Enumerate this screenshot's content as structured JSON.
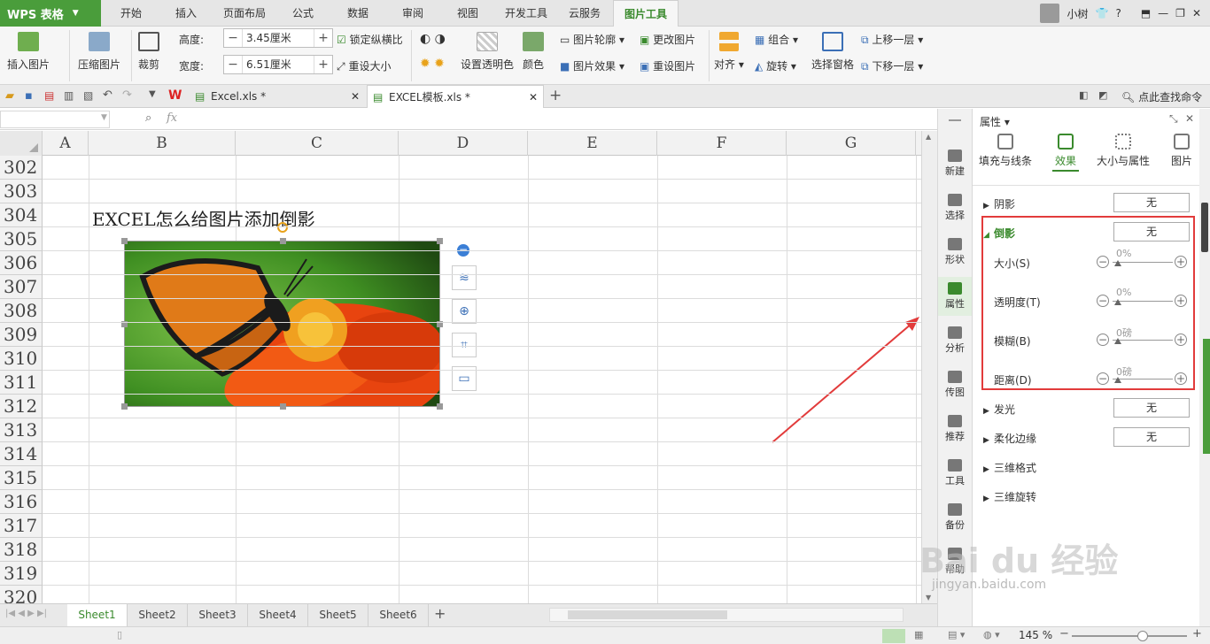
{
  "app": {
    "title": "WPS 表格"
  },
  "menu_tabs": [
    "开始",
    "插入",
    "页面布局",
    "公式",
    "数据",
    "审阅",
    "视图",
    "开发工具",
    "云服务",
    "图片工具"
  ],
  "active_tab": "图片工具",
  "user": {
    "name": "小树",
    "help": "?"
  },
  "ribbon": {
    "insert_picture": "插入图片",
    "compress_picture": "压缩图片",
    "crop": "裁剪",
    "height_label": "高度:",
    "height_value": "3.45厘米",
    "width_label": "宽度:",
    "width_value": "6.51厘米",
    "lock_ratio": "锁定纵横比",
    "reset_size": "重设大小",
    "set_transparent": "设置透明色",
    "color": "颜色",
    "picture_outline": "图片轮廓",
    "picture_effect": "图片效果",
    "change_picture": "更改图片",
    "reset_picture": "重设图片",
    "align": "对齐",
    "group": "组合",
    "rotate": "旋转",
    "selection_pane": "选择窗格",
    "bring_forward": "上移一层",
    "send_backward": "下移一层"
  },
  "doc_tabs": [
    {
      "name": "Excel.xls *",
      "active": false
    },
    {
      "name": "EXCEL模板.xls *",
      "active": true
    }
  ],
  "find_cmd": "点此查找命令",
  "formula_bar": {
    "fx": "fx"
  },
  "columns": [
    "A",
    "B",
    "C",
    "D",
    "E",
    "F",
    "G"
  ],
  "rows": [
    "302",
    "303",
    "304",
    "305",
    "306",
    "307",
    "308",
    "309",
    "310",
    "311",
    "312",
    "313",
    "314",
    "315",
    "316",
    "317",
    "318",
    "319",
    "320"
  ],
  "cell_text": "EXCEL怎么给图片添加倒影",
  "sheets": [
    "Sheet1",
    "Sheet2",
    "Sheet3",
    "Sheet4",
    "Sheet5",
    "Sheet6"
  ],
  "active_sheet": "Sheet1",
  "status": {
    "zoom": "145 %"
  },
  "side_nav": [
    "新建",
    "选择",
    "形状",
    "属性",
    "分析",
    "传图",
    "推荐",
    "工具",
    "备份",
    "帮助"
  ],
  "panel": {
    "title": "属性",
    "tabs": [
      "填充与线条",
      "效果",
      "大小与属性",
      "图片"
    ],
    "active_tab": "效果",
    "shadow": "阴影",
    "reflection": "倒影",
    "none": "无",
    "size": "大小(S)",
    "transparency": "透明度(T)",
    "blur": "模糊(B)",
    "distance": "距离(D)",
    "pct0": "0%",
    "pt0": "0磅",
    "glow": "发光",
    "soft_edges": "柔化边缘",
    "format_3d": "三维格式",
    "rotate_3d": "三维旋转"
  },
  "watermark": {
    "brand": "Bai du 经验",
    "url": "jingyan.baidu.com"
  },
  "colors": {
    "accent": "#3a8a2d",
    "highlight": "#e23b3b",
    "wps_green": "#4a9d3b"
  }
}
